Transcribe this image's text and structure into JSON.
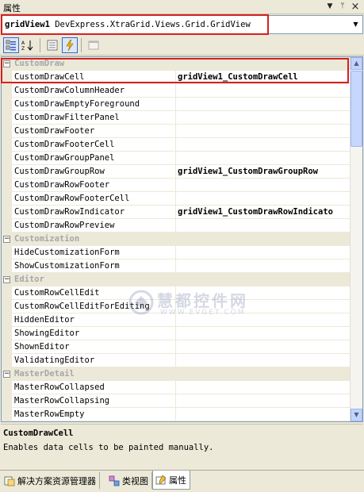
{
  "window": {
    "title": "属性",
    "controls": {
      "dropdown": "▼",
      "pin": "ᛘ",
      "close": "×"
    }
  },
  "object_selector": {
    "name": "gridView1",
    "type": "DevExpress.XtraGrid.Views.Grid.GridView"
  },
  "toolbar": {
    "buttons": [
      "categorized-icon",
      "alphabetical-icon",
      "properties-icon",
      "events-icon",
      "property-pages-icon"
    ]
  },
  "grid": {
    "rows": [
      {
        "kind": "category",
        "name": "CustomDraw",
        "expanded": true
      },
      {
        "kind": "event",
        "name": "CustomDrawCell",
        "value": "gridView1_CustomDrawCell",
        "selected": true
      },
      {
        "kind": "event",
        "name": "CustomDrawColumnHeader",
        "value": ""
      },
      {
        "kind": "event",
        "name": "CustomDrawEmptyForeground",
        "value": ""
      },
      {
        "kind": "event",
        "name": "CustomDrawFilterPanel",
        "value": ""
      },
      {
        "kind": "event",
        "name": "CustomDrawFooter",
        "value": ""
      },
      {
        "kind": "event",
        "name": "CustomDrawFooterCell",
        "value": ""
      },
      {
        "kind": "event",
        "name": "CustomDrawGroupPanel",
        "value": ""
      },
      {
        "kind": "event",
        "name": "CustomDrawGroupRow",
        "value": "gridView1_CustomDrawGroupRow"
      },
      {
        "kind": "event",
        "name": "CustomDrawRowFooter",
        "value": ""
      },
      {
        "kind": "event",
        "name": "CustomDrawRowFooterCell",
        "value": ""
      },
      {
        "kind": "event",
        "name": "CustomDrawRowIndicator",
        "value": "gridView1_CustomDrawRowIndicato"
      },
      {
        "kind": "event",
        "name": "CustomDrawRowPreview",
        "value": ""
      },
      {
        "kind": "category",
        "name": "Customization",
        "expanded": true
      },
      {
        "kind": "event",
        "name": "HideCustomizationForm",
        "value": ""
      },
      {
        "kind": "event",
        "name": "ShowCustomizationForm",
        "value": ""
      },
      {
        "kind": "category",
        "name": "Editor",
        "expanded": true
      },
      {
        "kind": "event",
        "name": "CustomRowCellEdit",
        "value": ""
      },
      {
        "kind": "event",
        "name": "CustomRowCellEditForEditing",
        "value": ""
      },
      {
        "kind": "event",
        "name": "HiddenEditor",
        "value": ""
      },
      {
        "kind": "event",
        "name": "ShowingEditor",
        "value": ""
      },
      {
        "kind": "event",
        "name": "ShownEditor",
        "value": ""
      },
      {
        "kind": "event",
        "name": "ValidatingEditor",
        "value": ""
      },
      {
        "kind": "category",
        "name": "MasterDetail",
        "expanded": true
      },
      {
        "kind": "event",
        "name": "MasterRowCollapsed",
        "value": ""
      },
      {
        "kind": "event",
        "name": "MasterRowCollapsing",
        "value": ""
      },
      {
        "kind": "event",
        "name": "MasterRowEmpty",
        "value": ""
      }
    ]
  },
  "description": {
    "title": "CustomDrawCell",
    "text": "Enables data cells to be painted manually."
  },
  "watermark": {
    "line1": "慧都控件网",
    "line2": "WWW.EVGET.COM"
  },
  "tabs": [
    {
      "label": "解决方案资源管理器",
      "icon": "solution-explorer-icon",
      "active": false
    },
    {
      "label": "类视图",
      "icon": "class-view-icon",
      "active": false
    },
    {
      "label": "属性",
      "icon": "properties-icon",
      "active": true
    }
  ],
  "colors": {
    "highlight": "#d62020",
    "category_text": "#a7a6aa",
    "panel": "#ece9d8"
  }
}
